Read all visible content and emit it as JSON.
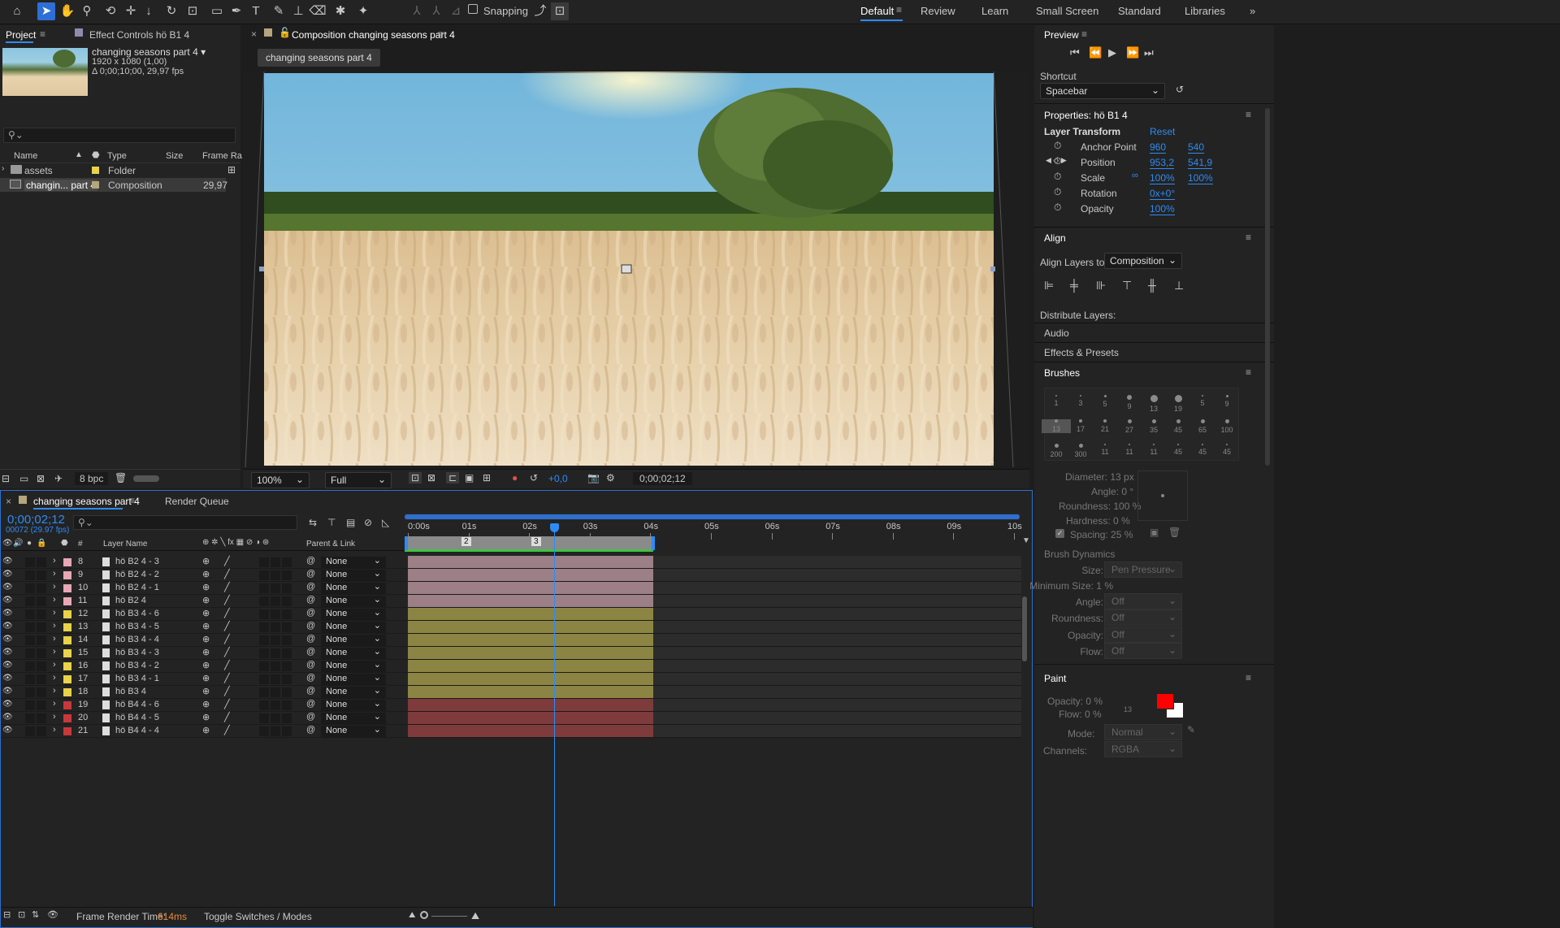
{
  "toolbar": {
    "snapping_label": "Snapping",
    "workspaces": [
      "Default",
      "Review",
      "Learn",
      "Small Screen",
      "Standard",
      "Libraries"
    ],
    "more": "»"
  },
  "project": {
    "tab_project": "Project",
    "tab_effect_controls": "Effect Controls hö B1 4",
    "comp_name": "changing seasons part 4 ▾",
    "comp_size": "1920 x 1080 (1,00)",
    "comp_duration": "Δ 0;00;10;00, 29,97 fps",
    "columns": [
      "Name",
      "Type",
      "Size",
      "Frame Ra..."
    ],
    "items": [
      {
        "name": "assets",
        "type": "Folder",
        "fps": "",
        "color": "#e8d34a"
      },
      {
        "name": "changin... part 4",
        "type": "Composition",
        "fps": "29,97",
        "color": "#b6a57d"
      }
    ],
    "bpc": "8 bpc"
  },
  "composition": {
    "tab_title": "Composition changing seasons part 4",
    "breadcrumb": "changing seasons part 4",
    "zoom": "100%",
    "resolution": "Full",
    "exposure": "+0,0",
    "timecode": "0;00;02;12"
  },
  "timeline": {
    "tab_comp": "changing seasons part 4",
    "tab_render": "Render Queue",
    "current_time": "0;00;02;12",
    "frame_info": "00072 (29.97 fps)",
    "col_layer_name": "Layer Name",
    "col_parent": "Parent & Link",
    "col_hash": "#",
    "ruler": [
      "0:00s",
      "01s",
      "02s",
      "03s",
      "04s",
      "05s",
      "06s",
      "07s",
      "08s",
      "09s",
      "10s"
    ],
    "markers": [
      "2",
      "3"
    ],
    "layers": [
      {
        "num": "8",
        "name": "hö B2 4 - 3",
        "parent": "None",
        "color": "#e8a7b5",
        "bar": "#9c7f87"
      },
      {
        "num": "9",
        "name": "hö B2 4 - 2",
        "parent": "None",
        "color": "#e8a7b5",
        "bar": "#9c7f87"
      },
      {
        "num": "10",
        "name": "hö B2 4 - 1",
        "parent": "None",
        "color": "#e8a7b5",
        "bar": "#9c7f87"
      },
      {
        "num": "11",
        "name": "hö B2 4",
        "parent": "None",
        "color": "#e8a7b5",
        "bar": "#9c7f87"
      },
      {
        "num": "12",
        "name": "hö B3 4 - 6",
        "parent": "None",
        "color": "#e8d34a",
        "bar": "#8c8443"
      },
      {
        "num": "13",
        "name": "hö B3 4 - 5",
        "parent": "None",
        "color": "#e8d34a",
        "bar": "#8c8443"
      },
      {
        "num": "14",
        "name": "hö B3 4 - 4",
        "parent": "None",
        "color": "#e8d34a",
        "bar": "#8c8443"
      },
      {
        "num": "15",
        "name": "hö B3 4 - 3",
        "parent": "None",
        "color": "#e8d34a",
        "bar": "#8c8443"
      },
      {
        "num": "16",
        "name": "hö B3 4 - 2",
        "parent": "None",
        "color": "#e8d34a",
        "bar": "#8c8443"
      },
      {
        "num": "17",
        "name": "hö B3 4 - 1",
        "parent": "None",
        "color": "#e8d34a",
        "bar": "#8c8443"
      },
      {
        "num": "18",
        "name": "hö B3 4",
        "parent": "None",
        "color": "#e8d34a",
        "bar": "#8c8443"
      },
      {
        "num": "19",
        "name": "hö B4 4 - 6",
        "parent": "None",
        "color": "#c8383a",
        "bar": "#7f3b3b"
      },
      {
        "num": "20",
        "name": "hö B4 4 - 5",
        "parent": "None",
        "color": "#c8383a",
        "bar": "#7f3b3b"
      },
      {
        "num": "21",
        "name": "hö B4 4 - 4",
        "parent": "None",
        "color": "#c8383a",
        "bar": "#7f3b3b"
      }
    ],
    "frame_render_label": "Frame Render Time:",
    "frame_render_value": "614ms",
    "toggle_label": "Toggle Switches / Modes"
  },
  "right": {
    "preview_title": "Preview",
    "shortcut_label": "Shortcut",
    "shortcut_value": "Spacebar",
    "properties_title": "Properties: hö B1 4",
    "layer_transform": "Layer Transform",
    "reset": "Reset",
    "props": [
      {
        "label": "Anchor Point",
        "v1": "960",
        "v2": "540"
      },
      {
        "label": "Position",
        "v1": "953,2",
        "v2": "541,9"
      },
      {
        "label": "Scale",
        "v1": "100%",
        "v2": "100%"
      },
      {
        "label": "Rotation",
        "v1": "0x+0°",
        "v2": ""
      },
      {
        "label": "Opacity",
        "v1": "100%",
        "v2": ""
      }
    ],
    "align_title": "Align",
    "align_to_label": "Align Layers to:",
    "align_to_value": "Composition",
    "distribute_label": "Distribute Layers:",
    "audio": "Audio",
    "effects_presets": "Effects & Presets",
    "brushes_title": "Brushes",
    "brush_sizes": [
      "1",
      "3",
      "5",
      "9",
      "13",
      "19",
      "5",
      "9",
      "13",
      "17",
      "21",
      "27",
      "35",
      "45",
      "65",
      "100",
      "200",
      "300",
      "11",
      "11",
      "11",
      "45",
      "45",
      "45"
    ],
    "diameter": "Diameter: 13 px",
    "angle": "Angle: 0 °",
    "roundness": "Roundness: 100 %",
    "hardness": "Hardness: 0 %",
    "spacing": "Spacing: 25 %",
    "brush_dynamics": "Brush Dynamics",
    "dyn": [
      {
        "label": "Size:",
        "value": "Pen Pressure"
      },
      {
        "label": "Minimum Size: 1 %",
        "value": ""
      },
      {
        "label": "Angle:",
        "value": "Off"
      },
      {
        "label": "Roundness:",
        "value": "Off"
      },
      {
        "label": "Opacity:",
        "value": "Off"
      },
      {
        "label": "Flow:",
        "value": "Off"
      }
    ],
    "paint_title": "Paint",
    "paint_opacity": "Opacity: 0 %",
    "paint_flow": "Flow: 0 %",
    "paint_num": "13",
    "mode_label": "Mode:",
    "mode_value": "Normal",
    "channels_label": "Channels:",
    "channels_value": "RGBA",
    "fg_color": "#ff0000",
    "bg_color": "#ffffff"
  }
}
